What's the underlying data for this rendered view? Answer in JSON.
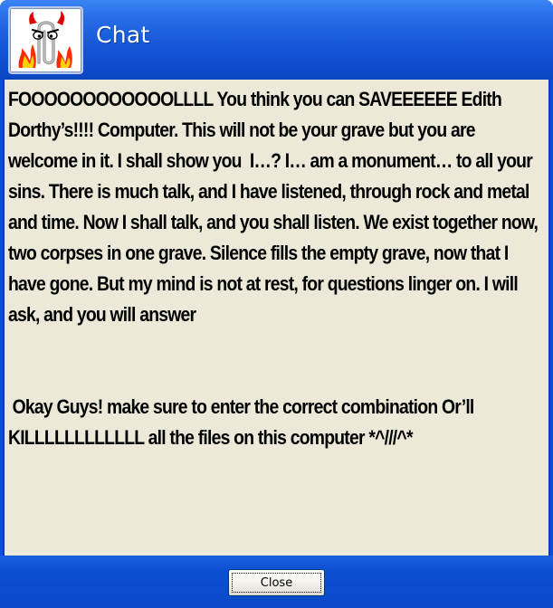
{
  "window": {
    "title": "Chat",
    "avatar_icon": "paperclip-devil-icon"
  },
  "message": {
    "paragraph_1": "FOOOOOOOOOOOOLLLL You think you can SAVEEEEEE Edith Dorthy’s!!!! Computer. This will not be your grave but you are welcome in it. I shall show you  I…? I… am a monument… to all your sins. There is much talk, and I have listened, through rock and metal and time. Now I shall talk, and you shall listen. We exist together now, two corpses in one grave. Silence fills the empty grave, now that I have gone. But my mind is not at rest, for questions linger on. I will ask, and you will answer",
    "paragraph_2": " Okay Guys! make sure to enter the correct combination Or’ll KILLLLLLLLLLLL all the files on this computer *^///^*"
  },
  "footer": {
    "close_label": "Close"
  },
  "colors": {
    "titlebar": "#1658d8",
    "content_bg": "#ece9d8",
    "text": "#000000"
  }
}
